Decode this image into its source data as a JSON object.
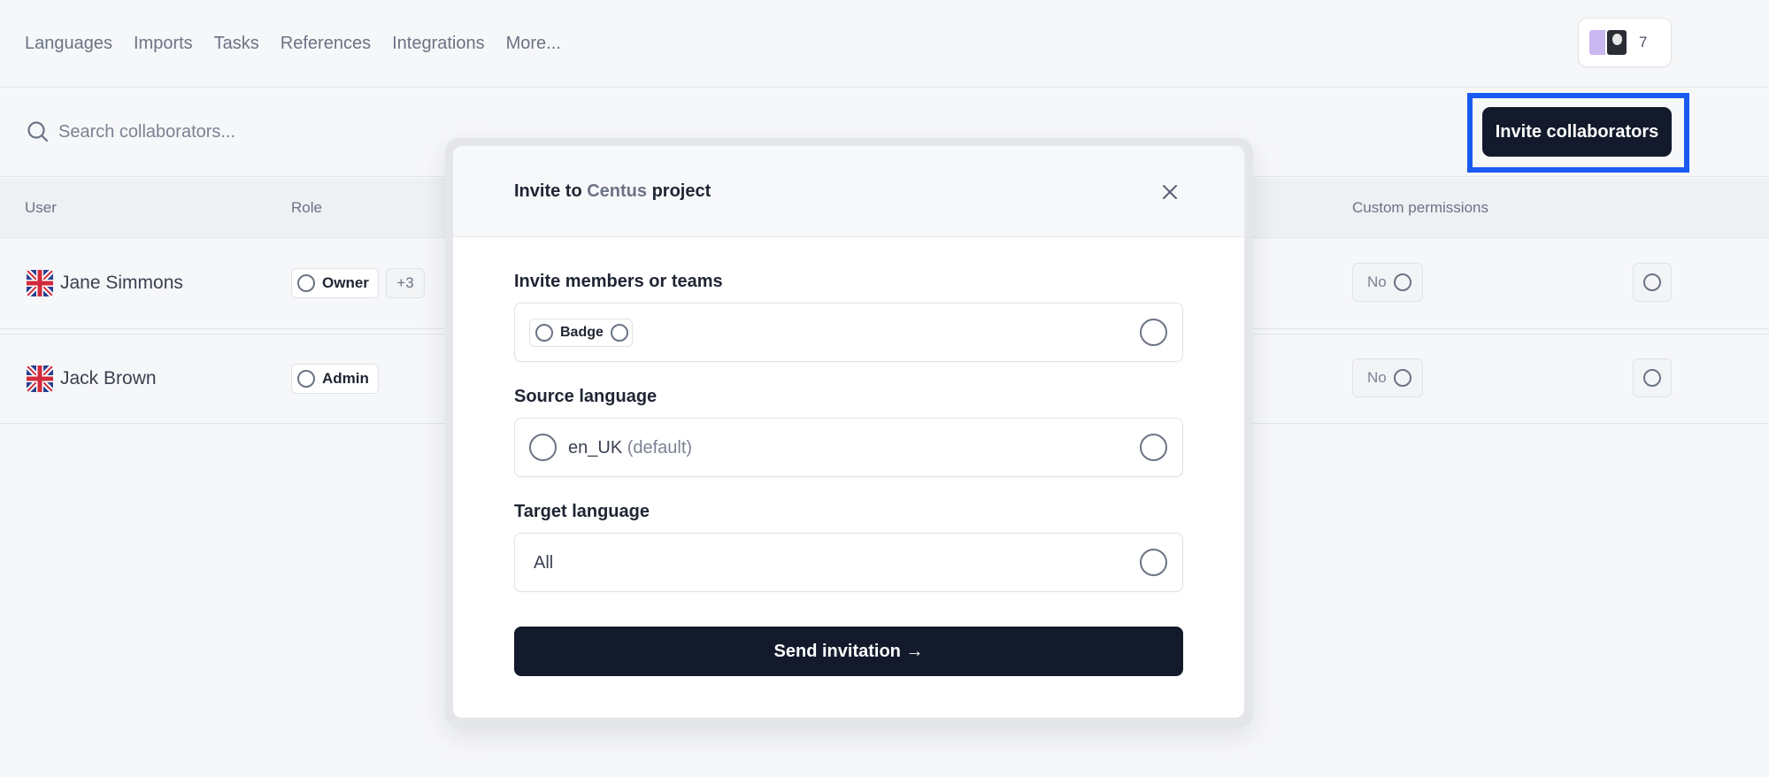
{
  "nav": {
    "items": [
      "Languages",
      "Imports",
      "Tasks",
      "References",
      "Integrations",
      "More..."
    ]
  },
  "avatars": {
    "count": "7"
  },
  "search": {
    "placeholder": "Search collaborators..."
  },
  "toolbar": {
    "invite_label": "Invite collaborators"
  },
  "table": {
    "headers": {
      "user": "User",
      "role": "Role",
      "custom_permissions": "Custom permissions"
    },
    "rows": [
      {
        "name": "Jane Simmons",
        "role": "Owner",
        "extra": "+3",
        "custom": "No"
      },
      {
        "name": "Jack Brown",
        "role": "Admin",
        "custom": "No"
      }
    ]
  },
  "modal": {
    "title_prefix": "Invite to ",
    "project_name": "Centus",
    "title_suffix": " project",
    "members_label": "Invite members or teams",
    "members_chip": "Badge",
    "source_label": "Source language",
    "source_value": "en_UK",
    "source_default": "(default)",
    "target_label": "Target language",
    "target_value": "All",
    "send_label": "Send invitation →"
  },
  "colors": {
    "primary_button": "#121a2b",
    "highlight": "#1a5af0",
    "muted_text": "#6b7384",
    "background": "#f6f7f9"
  }
}
